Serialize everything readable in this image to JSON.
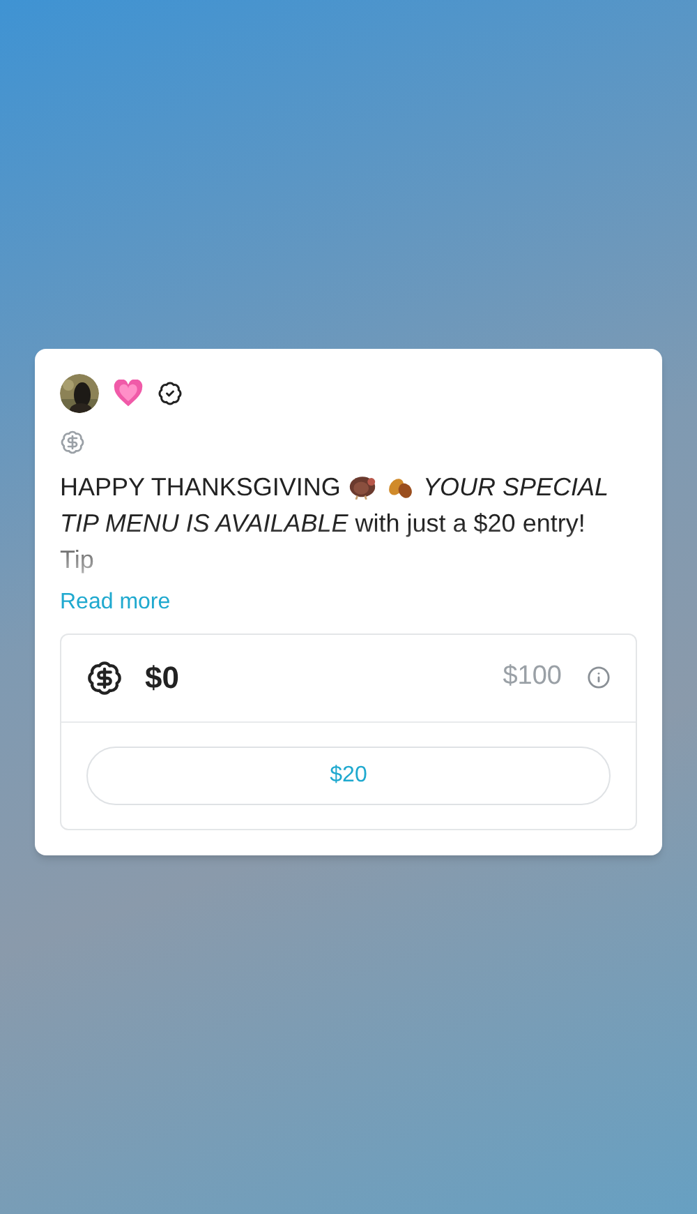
{
  "post": {
    "lead": "HAPPY THANKSGIVING",
    "body": "*YOUR SPECIAL TIP MENU IS AVAILABLE* with just a $20 entry! Tip",
    "read_more": "Read more"
  },
  "tip": {
    "amount": "$0",
    "max": "$100",
    "button": "$20"
  }
}
